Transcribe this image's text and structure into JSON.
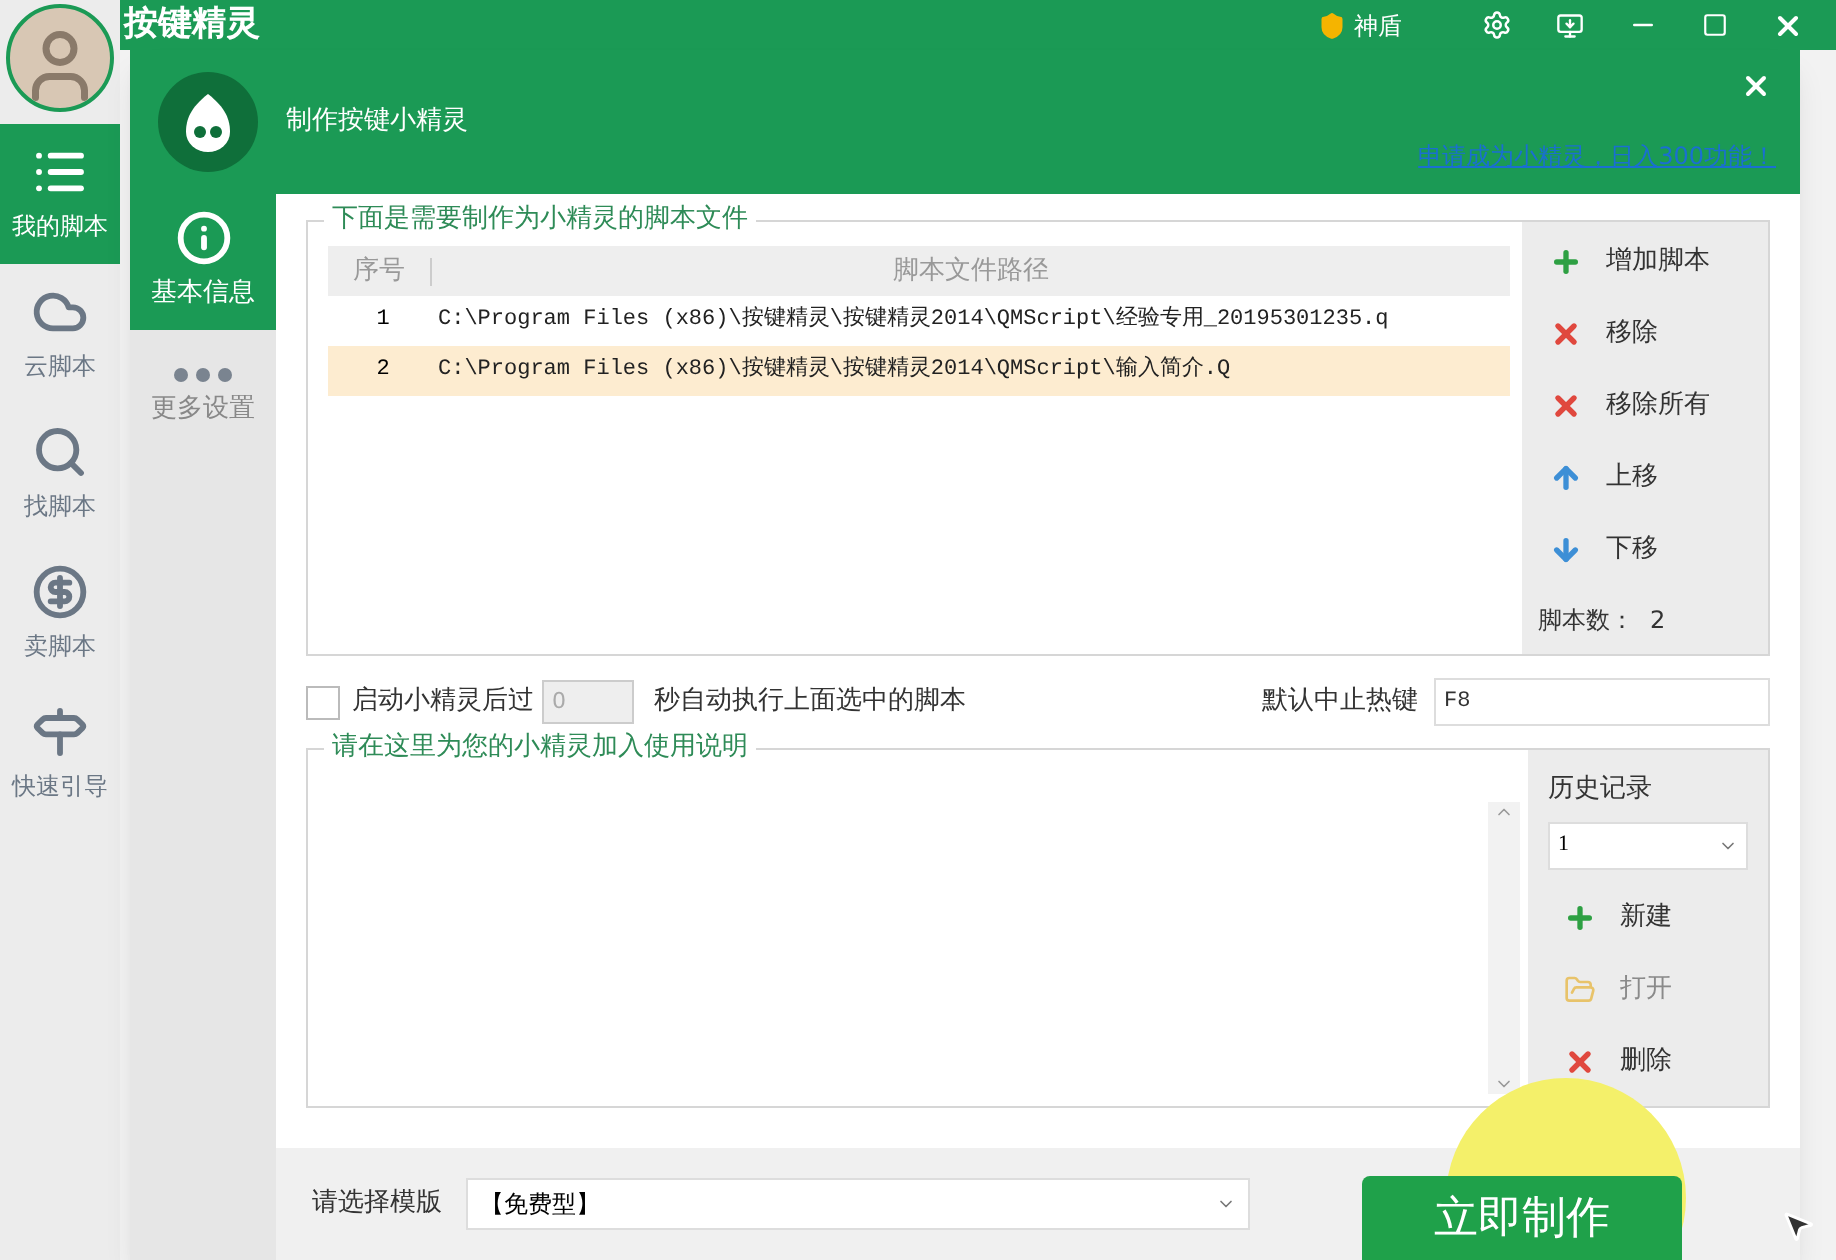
{
  "app": {
    "title": "按键精灵",
    "shield_label": "神盾",
    "nav": [
      {
        "label": "我的脚本",
        "selected": true
      },
      {
        "label": "云脚本",
        "selected": false
      },
      {
        "label": "找脚本",
        "selected": false
      },
      {
        "label": "卖脚本",
        "selected": false
      },
      {
        "label": "快速引导",
        "selected": false
      }
    ]
  },
  "dialog": {
    "title": "制作按键小精灵",
    "link": "申请成为小精灵，日入300功能！",
    "nav": [
      {
        "label": "基本信息",
        "selected": true
      },
      {
        "label": "更多设置",
        "selected": false
      }
    ],
    "script_group": {
      "legend": "下面是需要制作为小精灵的脚本文件",
      "columns": [
        "序号",
        "脚本文件路径"
      ],
      "rows": [
        {
          "index": "1",
          "path": "C:\\Program Files (x86)\\按键精灵\\按键精灵2014\\QMScript\\经验专用_20195301235.q",
          "selected": false
        },
        {
          "index": "2",
          "path": "C:\\Program Files (x86)\\按键精灵\\按键精灵2014\\QMScript\\输入简介.Q",
          "selected": true
        }
      ],
      "actions": [
        {
          "label": "增加脚本",
          "disabled": false
        },
        {
          "label": "移除",
          "disabled": false
        },
        {
          "label": "移除所有",
          "disabled": false
        },
        {
          "label": "上移",
          "disabled": false
        },
        {
          "label": "下移",
          "disabled": false
        }
      ],
      "count_label": "脚本数：",
      "count": "2"
    },
    "auto_run": {
      "checked": false,
      "label_before": "启动小精灵后过",
      "seconds": "0",
      "label_after": "秒自动执行上面选中的脚本"
    },
    "hotkey": {
      "label": "默认中止热键",
      "value": "F8"
    },
    "description": {
      "legend": "请在这里为您的小精灵加入使用说明",
      "history": {
        "label": "历史记录",
        "value": "1"
      },
      "actions": [
        {
          "label": "新建",
          "disabled": false
        },
        {
          "label": "打开",
          "disabled": true
        },
        {
          "label": "删除",
          "disabled": false
        }
      ]
    },
    "template": {
      "label": "请选择模版",
      "value": "【免费型】"
    },
    "submit": "立即制作"
  }
}
